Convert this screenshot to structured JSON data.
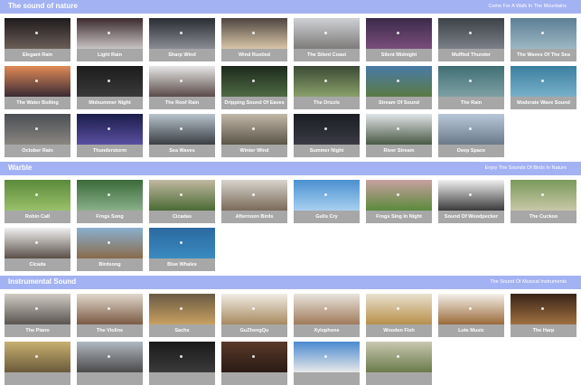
{
  "sections": [
    {
      "title": "The sound of nature",
      "subtitle": "Come For A Walk In The Mountains",
      "items": [
        {
          "label": "Elegant Rain",
          "top": "#1e1a1c",
          "bottom": "#6b5e58"
        },
        {
          "label": "Light Rain",
          "top": "#3b2a2e",
          "bottom": "#c9c3c4"
        },
        {
          "label": "Sharp Wind",
          "top": "#2a2c34",
          "bottom": "#8a8c94"
        },
        {
          "label": "Wind Rustled",
          "top": "#4e4540",
          "bottom": "#d9c6a8"
        },
        {
          "label": "The Silent Coast",
          "top": "#cfd0d4",
          "bottom": "#7d7c7a"
        },
        {
          "label": "Silent Midnight",
          "top": "#3b2a4a",
          "bottom": "#7a4d7a"
        },
        {
          "label": "Muffled Thunder",
          "top": "#3d4248",
          "bottom": "#7a8088"
        },
        {
          "label": "The Waves Of The Sea",
          "top": "#5c7f94",
          "bottom": "#9db7c4"
        },
        {
          "label": "The Water Boiling",
          "top": "#e08a57",
          "bottom": "#3a2a34"
        },
        {
          "label": "Midsummer Night",
          "top": "#1c1c1c",
          "bottom": "#3a3a3a"
        },
        {
          "label": "The Roof Rain",
          "top": "#e7e7e7",
          "bottom": "#5a4a48"
        },
        {
          "label": "Dripping Sound Of Eaves",
          "top": "#1c2a1c",
          "bottom": "#4f6a44"
        },
        {
          "label": "The Drizzle",
          "top": "#3a4a34",
          "bottom": "#8aa06a"
        },
        {
          "label": "Stream Of Sound",
          "top": "#4a7aa8",
          "bottom": "#5a7a44"
        },
        {
          "label": "The Rain",
          "top": "#3f6f74",
          "bottom": "#7ea0a4"
        },
        {
          "label": "Moderate Wave Sound",
          "top": "#3c7fa0",
          "bottom": "#78b0c8"
        },
        {
          "label": "October Rain",
          "top": "#4a4e54",
          "bottom": "#8a8680"
        },
        {
          "label": "Thunderstorm",
          "top": "#1a1e4a",
          "bottom": "#5a4ea0"
        },
        {
          "label": "Sea Waves",
          "top": "#b8c4cc",
          "bottom": "#3a3e44"
        },
        {
          "label": "Winter Wind",
          "top": "#c2b8a8",
          "bottom": "#5a5448"
        },
        {
          "label": "Summer Night",
          "top": "#1a1e24",
          "bottom": "#3a3a44"
        },
        {
          "label": "River Stream",
          "top": "#e0e4e8",
          "bottom": "#4a5a44"
        },
        {
          "label": "Deep Space",
          "top": "#b8c8d8",
          "bottom": "#6a7a8a"
        }
      ]
    },
    {
      "title": "Warble",
      "subtitle": "Enjoy The Sounds Of Birds In Nature",
      "items": [
        {
          "label": "Robin Call",
          "top": "#5a8a3a",
          "bottom": "#9ac06a"
        },
        {
          "label": "Frogs Song",
          "top": "#3a6a3a",
          "bottom": "#8ab08a"
        },
        {
          "label": "Cicadas",
          "top": "#c0b8a0",
          "bottom": "#4a6a34"
        },
        {
          "label": "Afternoon Birds",
          "top": "#d8d4cc",
          "bottom": "#7a6a5a"
        },
        {
          "label": "Gulls Cry",
          "top": "#4a90d0",
          "bottom": "#a8d0f0"
        },
        {
          "label": "Frogs Sing In Night",
          "top": "#c8a0a0",
          "bottom": "#5a8a3a"
        },
        {
          "label": "Sound Of Woodpecker",
          "top": "#f0f0f0",
          "bottom": "#3a3a3a"
        },
        {
          "label": "The Cuckoo",
          "top": "#7a9a5a",
          "bottom": "#c8c8a8"
        },
        {
          "label": "Cicada",
          "top": "#f0f0f0",
          "bottom": "#5a5048"
        },
        {
          "label": "Birdsong",
          "top": "#8ab0d0",
          "bottom": "#8a6a4a"
        },
        {
          "label": "Blue Whales",
          "top": "#2a6aa0",
          "bottom": "#3a8ac0"
        }
      ]
    },
    {
      "title": "Instrumental Sound",
      "subtitle": "The Sound Of Musical Instruments",
      "items": [
        {
          "label": "The Piano",
          "top": "#d0ccc4",
          "bottom": "#5a5450"
        },
        {
          "label": "The Violins",
          "top": "#e0d8cc",
          "bottom": "#7a5a44"
        },
        {
          "label": "Sachs",
          "top": "#6a5a44",
          "bottom": "#c8a060"
        },
        {
          "label": "GuZhengQu",
          "top": "#f0ece4",
          "bottom": "#a88a60"
        },
        {
          "label": "Xylophone",
          "top": "#e8e4dc",
          "bottom": "#a07a5a"
        },
        {
          "label": "Wooden Fish",
          "top": "#e8e0d0",
          "bottom": "#b8904a"
        },
        {
          "label": "Lute Music",
          "top": "#f4f0ea",
          "bottom": "#9a6a3a"
        },
        {
          "label": "The Harp",
          "top": "#3a2418",
          "bottom": "#a07040"
        },
        {
          "label": "",
          "top": "#c8b070",
          "bottom": "#6a5a3a"
        },
        {
          "label": "",
          "top": "#b0b8c0",
          "bottom": "#4a4a4a"
        },
        {
          "label": "",
          "top": "#1a1a1a",
          "bottom": "#3a3a3a"
        },
        {
          "label": "",
          "top": "#5a3a2a",
          "bottom": "#2a1a14"
        },
        {
          "label": "",
          "top": "#4a8ad0",
          "bottom": "#e8e8e8"
        },
        {
          "label": "",
          "top": "#c8c8b0",
          "bottom": "#6a7a4a"
        }
      ]
    }
  ]
}
